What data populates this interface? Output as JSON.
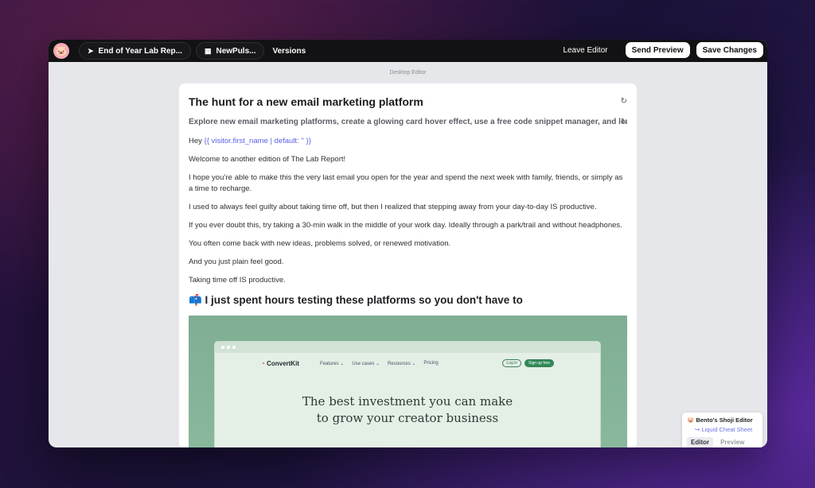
{
  "topbar": {
    "tabs": [
      {
        "icon": "paper-plane-icon",
        "label": "End of Year Lab Rep..."
      },
      {
        "icon": "newsletter-icon",
        "label": "NewPuls..."
      }
    ],
    "versions_label": "Versions",
    "leave_label": "Leave Editor",
    "send_preview_label": "Send Preview",
    "save_label": "Save Changes"
  },
  "canvas": {
    "mode_label": "Desktop Editor"
  },
  "email": {
    "title": "The hunt for a new email marketing platform",
    "preview_text": "Explore new email marketing platforms, create a glowing card hover effect, use a free code snippet manager, and lea",
    "greeting_prefix": "Hey ",
    "greeting_liquid": "{{ visitor.first_name | default: '' }}",
    "paragraphs": [
      "Welcome to another edition of The Lab Report!",
      "I hope you’re able to make this the very last email you open for the year and spend the next week with family, friends, or simply as a time to recharge.",
      "I used to always feel guilty about taking time off, but then I realized that stepping away from your day-to-day IS productive.",
      "If you ever doubt this, try taking a 30-min walk in the middle of your work day. Ideally through a park/trail and without headphones.",
      "You often come back with new ideas, problems solved, or renewed motivation.",
      "And you just plain feel good.",
      "Taking time off IS productive."
    ],
    "section_heading": "📫 I just spent hours testing these platforms so you don't have to",
    "hero": {
      "brand": "ConvertKit",
      "nav": [
        "Features ⌄",
        "Use cases ⌄",
        "Resources ⌄",
        "Pricing"
      ],
      "login": "Log in",
      "signup": "Sign up free",
      "headline_line1": "The best investment you can make",
      "headline_line2": "to grow your creator business"
    }
  },
  "side_panel": {
    "title": "Bento's Shoji Editor",
    "link": "Liquid Cheat Sheet",
    "tabs": [
      "Editor",
      "Preview"
    ]
  }
}
